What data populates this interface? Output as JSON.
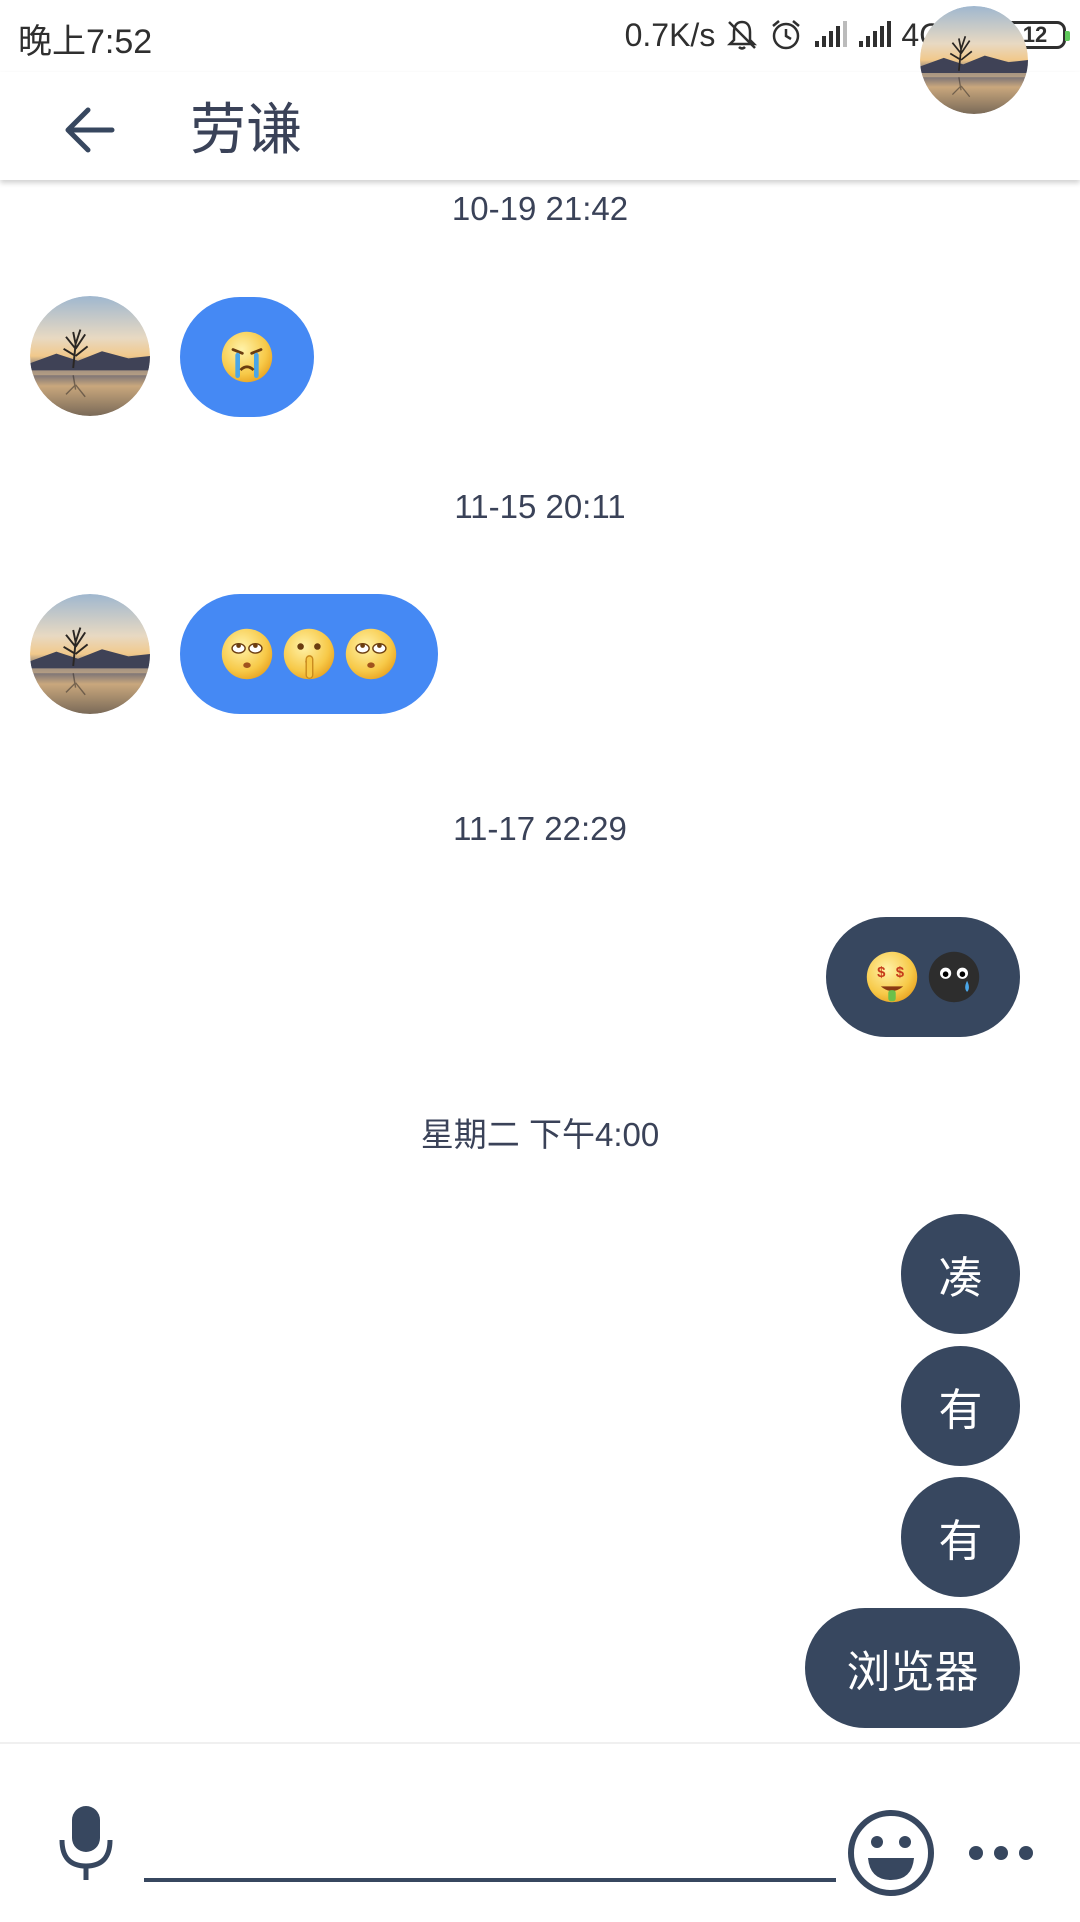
{
  "status_bar": {
    "time": "晚上7:52",
    "net_speed": "0.7K/s",
    "network": "4G",
    "battery": "12"
  },
  "header": {
    "title": "劳谦",
    "back_icon": "arrow-left-icon",
    "avatar_icon": "contact-avatar"
  },
  "messages": {
    "timestamps": [
      "10-19 21:42",
      "11-15 20:11",
      "11-17 22:29",
      "星期二 下午4:00"
    ],
    "m1_emojis": [
      "crying-emoji"
    ],
    "m2_emojis": [
      "eye-roll-emoji",
      "shush-emoji",
      "eye-roll-emoji"
    ],
    "m3_emojis": [
      "money-mouth-emoji",
      "sad-dark-emoji"
    ],
    "m4_text": "凑",
    "m5_text": "有",
    "m6_text": "有",
    "m7_text": "浏览器"
  },
  "input": {
    "placeholder": "",
    "mic_icon": "microphone-icon",
    "emoji_icon": "smiley-icon",
    "more_icon": "more-dots-icon"
  },
  "colors": {
    "incoming_bubble": "#4589f4",
    "outgoing_bubble": "#37475f",
    "text": "#3a4258"
  }
}
